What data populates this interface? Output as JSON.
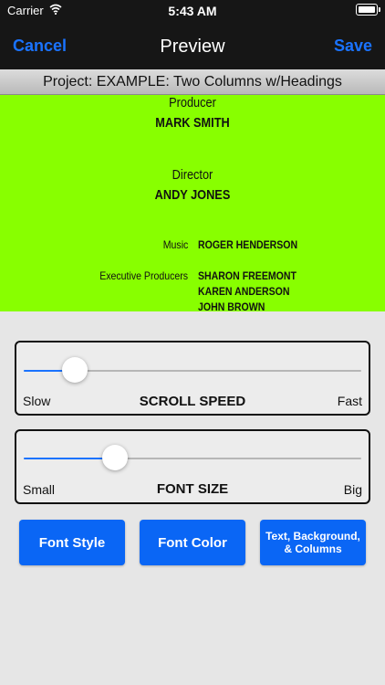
{
  "status": {
    "carrier": "Carrier",
    "time": "5:43 AM"
  },
  "nav": {
    "cancel": "Cancel",
    "title": "Preview",
    "save": "Save"
  },
  "project": {
    "label": "Project: EXAMPLE: Two Columns w/Headings"
  },
  "preview": {
    "background": "#88ff00",
    "producer_heading": "Producer",
    "producer_name": "MARK SMITH",
    "director_heading": "Director",
    "director_name": "ANDY JONES",
    "music_role": "Music",
    "music_name": "ROGER HENDERSON",
    "exec_role": "Executive Producers",
    "exec_names": [
      "SHARON FREEMONT",
      "KAREN ANDERSON",
      "JOHN BROWN"
    ]
  },
  "scroll_speed": {
    "label": "SCROLL SPEED",
    "min_label": "Slow",
    "max_label": "Fast",
    "value": 0.15
  },
  "font_size": {
    "label": "FONT SIZE",
    "min_label": "Small",
    "max_label": "Big",
    "value": 0.27
  },
  "buttons": {
    "font_style": "Font Style",
    "font_color": "Font Color",
    "text_bg_columns": "Text, Background, & Columns"
  },
  "colors": {
    "accent": "#1a73ff",
    "button": "#0a66f5",
    "nav_bg": "#161616"
  }
}
